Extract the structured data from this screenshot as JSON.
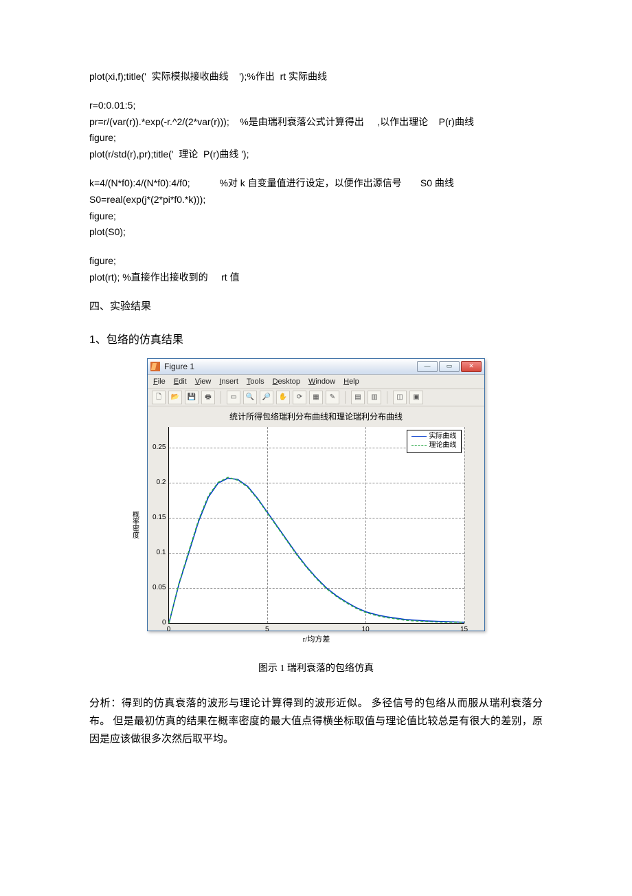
{
  "code": {
    "block1": "plot(xi,f);title('  实际模拟接收曲线    ');%作出  rt 实际曲线",
    "block2": "r=0:0.01:5;\npr=r/(var(r)).*exp(-r.^2/(2*var(r)));    %是由瑞利衰落公式计算得出     ,以作出理论    P(r)曲线\nfigure;\nplot(r/std(r),pr);title('  理论  P(r)曲线 ');",
    "block3": "k=4/(N*f0):4/(N*f0):4/f0;           %对 k 自变量值进行设定，以便作出源信号       S0 曲线\nS0=real(exp(j*(2*pi*f0.*k)));\nfigure;\nplot(S0);",
    "block4": "figure;\nplot(rt); %直接作出接收到的     rt 值"
  },
  "headings": {
    "section4": "四、实验结果",
    "sub1": "1、包络的仿真结果"
  },
  "matlab_window": {
    "title": "Figure 1",
    "menus": {
      "file": "File",
      "edit": "Edit",
      "view": "View",
      "insert": "Insert",
      "tools": "Tools",
      "desktop": "Desktop",
      "window": "Window",
      "help": "Help"
    },
    "plot_title": "统计所得包络瑞利分布曲线和理论瑞利分布曲线",
    "xaxis": "r/均方差",
    "yaxis": "概率密度",
    "legend": {
      "actual": "实际曲线",
      "theory": "理论曲线"
    }
  },
  "caption": "图示  1  瑞利衰落的包络仿真",
  "analysis": "分析：得到的仿真衰落的波形与理论计算得到的波形近似。     多径信号的包络从而服从瑞利衰落分布。 但是最初仿真的结果在概率密度的最大值点得横坐标取值与理论值比较总是有很大的差别，原因是应该做很多次然后取平均。",
  "chart_data": {
    "type": "line",
    "title": "统计所得包络瑞利分布曲线和理论瑞利分布曲线",
    "xlabel": "r/均方差",
    "ylabel": "概率密度",
    "xlim": [
      0,
      15
    ],
    "ylim": [
      0,
      0.28
    ],
    "xticks": [
      0,
      5,
      10,
      15
    ],
    "yticks": [
      0,
      0.05,
      0.1,
      0.15,
      0.2,
      0.25
    ],
    "series": [
      {
        "name": "实际曲线",
        "style": "solid",
        "color": "#0038cc",
        "x": [
          0,
          0.5,
          1,
          1.5,
          2,
          2.5,
          3,
          3.5,
          4,
          4.5,
          5,
          5.5,
          6,
          6.5,
          7,
          7.5,
          8,
          8.5,
          9,
          9.5,
          10,
          10.5,
          11,
          12,
          13,
          14,
          15
        ],
        "y": [
          0,
          0.055,
          0.1,
          0.145,
          0.18,
          0.2,
          0.207,
          0.205,
          0.195,
          0.178,
          0.158,
          0.138,
          0.118,
          0.098,
          0.08,
          0.064,
          0.05,
          0.039,
          0.03,
          0.022,
          0.016,
          0.012,
          0.009,
          0.005,
          0.003,
          0.002,
          0.001
        ]
      },
      {
        "name": "理论曲线",
        "style": "dashed",
        "color": "#2da84a",
        "x": [
          0,
          0.5,
          1,
          1.5,
          2,
          2.5,
          3,
          3.5,
          4,
          4.5,
          5,
          5.5,
          6,
          6.5,
          7,
          7.5,
          8,
          8.5,
          9,
          9.5,
          10,
          10.5,
          11,
          12,
          13,
          14,
          15
        ],
        "y": [
          0,
          0.056,
          0.102,
          0.147,
          0.182,
          0.201,
          0.208,
          0.204,
          0.194,
          0.177,
          0.157,
          0.137,
          0.117,
          0.097,
          0.079,
          0.063,
          0.049,
          0.038,
          0.029,
          0.021,
          0.015,
          0.011,
          0.008,
          0.004,
          0.002,
          0.001,
          0.001
        ]
      }
    ]
  }
}
